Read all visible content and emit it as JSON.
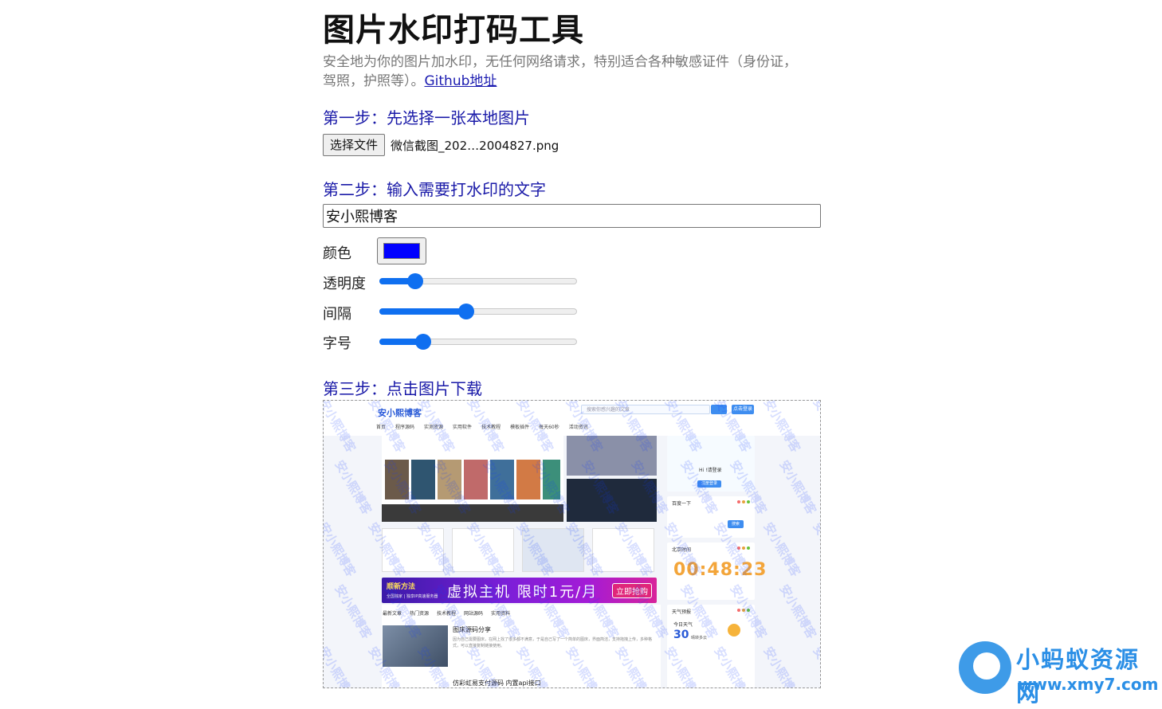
{
  "page": {
    "title": "图片水印打码工具",
    "subtitle_line1": "安全地为你的图片加水印，无任何网络请求，特别适合各种敏感证件（身份证，",
    "subtitle_line2": "驾照，护照等）。",
    "github_link": "Github地址"
  },
  "step1": {
    "label": "第一步：先选择一张本地图片",
    "button": "选择文件",
    "file_name": "微信截图_202…2004827.png"
  },
  "step2": {
    "label": "第二步：输入需要打水印的文字",
    "text_value": "安小熙博客",
    "color_label": "颜色",
    "color_value": "#0000ff",
    "opacity_label": "透明度",
    "opacity_fraction": 0.18,
    "spacing_label": "间隔",
    "spacing_fraction": 0.44,
    "fontsize_label": "字号",
    "fontsize_fraction": 0.22
  },
  "step3": {
    "label": "第三步：点击图片下载",
    "watermark_text": "安小熙博客"
  },
  "preview_site": {
    "logo": "安小熙博客",
    "search_placeholder": "搜索你感兴趣的文章",
    "login": "点击登录",
    "nav": [
      "首页",
      "程序源码",
      "实测资源",
      "实用软件",
      "技术教程",
      "模板插件",
      "每天60秒",
      "活动资讯"
    ],
    "banner_brand": "顺新方法",
    "banner_sub": "全国独家 | 独享IP高速服务器",
    "banner_text": "虚拟主机 限时1元/月",
    "banner_button": "立即抢购",
    "tabs": [
      "最新文章",
      "热门资源",
      "技术教程",
      "网站源码",
      "实用资料"
    ],
    "article_title": "图床源码分享",
    "article_desc": "因为自己需要图床，在网上找了很多都不满意，于是自己写了一个简单的图床，界面简洁，支持拖拽上传，多种格式，可以直接复制链接使用。",
    "article2_title": "仿彩虹易支付源码 内置api接口",
    "side_welcome": "Hi !请登录",
    "side_login_btn": "注册登录",
    "side_search_title": "百度一下",
    "side_search_btn": "搜索",
    "side_clock_title": "北京时间",
    "side_clock": "00:48:23",
    "side_weather_title": "天气预报",
    "side_weather_label": "今日天气",
    "side_weather_temp": "30",
    "side_weather_unit": "晴转多云"
  },
  "corner_logo": {
    "title": "小蚂蚁资源网",
    "url": "www.xmy7.com"
  },
  "colors": {
    "accent": "#0f6ff0",
    "step_text": "#1a1aa8"
  }
}
